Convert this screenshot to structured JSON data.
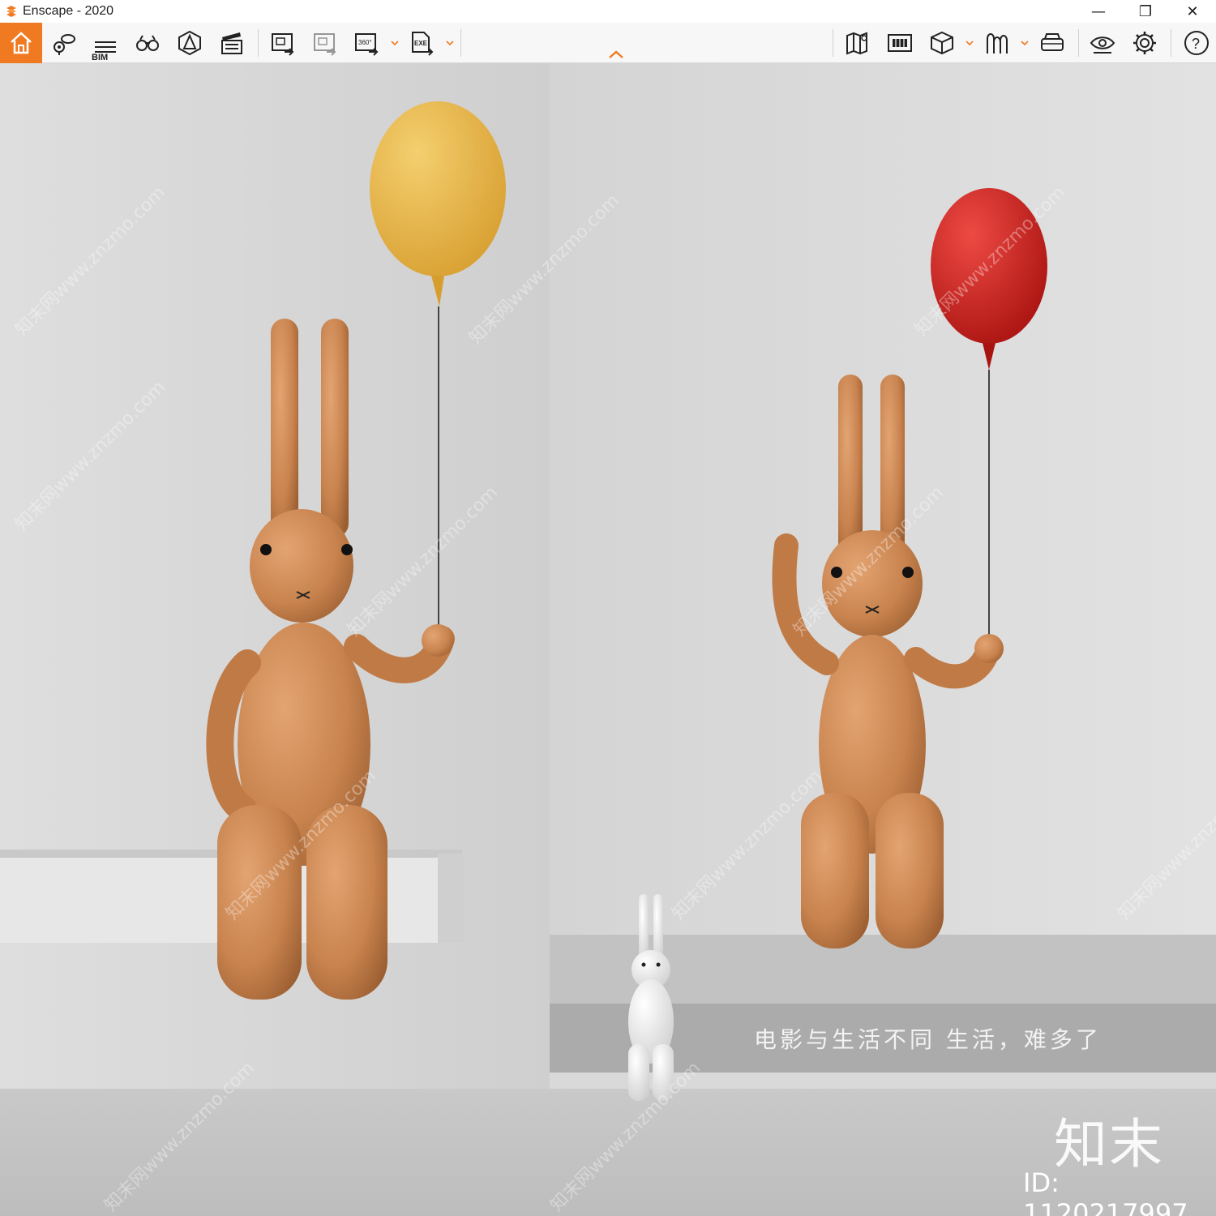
{
  "window": {
    "title": "Enscape - 2020",
    "controls": {
      "minimize": "—",
      "restore": "❐",
      "close": "✕"
    }
  },
  "toolbar": {
    "left_tools": [
      {
        "name": "home-icon"
      },
      {
        "name": "views-icon"
      },
      {
        "name": "bim-icon",
        "label": "BIM"
      },
      {
        "name": "binoculars-icon"
      },
      {
        "name": "assets-icon"
      },
      {
        "name": "video-editor-icon"
      },
      {
        "name": "screenshot-icon"
      },
      {
        "name": "batch-render-icon"
      },
      {
        "name": "export-360-icon",
        "label": "360°"
      },
      {
        "name": "export-exe-icon",
        "label": "EXE"
      }
    ],
    "right_tools": [
      {
        "name": "map-icon"
      },
      {
        "name": "material-icon"
      },
      {
        "name": "cube-icon"
      },
      {
        "name": "collaboration-icon"
      },
      {
        "name": "vr-headset-icon"
      },
      {
        "name": "eye-icon"
      },
      {
        "name": "settings-gear-icon"
      },
      {
        "name": "help-icon",
        "label": "?"
      }
    ],
    "accent_color": "#f07a22"
  },
  "viewport": {
    "caption": "电影与生活不同  生活，难多了",
    "watermark_logo": "知末",
    "watermark_id": "ID: 1120217997",
    "watermark_tile_text": "知末网www.znzmo.com",
    "colors": {
      "rabbit": "#c8834e",
      "yellow_balloon": "#e8b54a",
      "red_balloon": "#cf1f1f",
      "wall": "#dcdcdc"
    }
  }
}
